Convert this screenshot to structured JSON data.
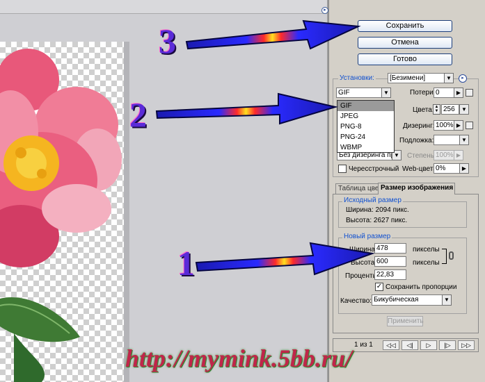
{
  "buttons": {
    "save": "Сохранить",
    "cancel": "Отмена",
    "done": "Готово"
  },
  "settings": {
    "label": "Установки:",
    "preset": "[Безимени]"
  },
  "format": {
    "value": "GIF",
    "options": [
      "GIF",
      "JPEG",
      "PNG-8",
      "PNG-24",
      "WBMP"
    ],
    "selected_index": 0
  },
  "loss": {
    "label": "Потери:",
    "value": "0"
  },
  "colors": {
    "label": "Цвета:",
    "value": "256"
  },
  "dither": {
    "label": "Дизеринг:",
    "value": "100%",
    "mode": "Без дизеринга пр..."
  },
  "matte": {
    "label": "Подложка:",
    "value": ""
  },
  "degree": {
    "label": "Степень:",
    "value": "100%"
  },
  "interlaced": {
    "label": "Чересстрочный"
  },
  "web_colors": {
    "label": "Web-цвета:",
    "value": "0%"
  },
  "tabs": {
    "color_table": "Таблица цвет",
    "image_size": "Размер изображения"
  },
  "original_size": {
    "title": "Исходный размер",
    "width": "Ширина: 2094 пикс.",
    "height": "Высота: 2627 пикс."
  },
  "new_size": {
    "title": "Новый размер",
    "width_label": "Ширина:",
    "width_value": "478",
    "width_unit": "пикселы",
    "height_label": "Высота:",
    "height_value": "600",
    "height_unit": "пикселы",
    "percent_label": "Проценты:",
    "percent_value": "22,83",
    "constrain_label": "Сохранить пропорции",
    "quality_label": "Качество:",
    "quality_value": "Бикубическая",
    "apply": "Применить"
  },
  "pager": {
    "text": "1 из 1"
  },
  "annotations": {
    "n1": "1",
    "n2": "2",
    "n3": "3"
  },
  "watermark": "http://mymink.5bb.ru/"
}
